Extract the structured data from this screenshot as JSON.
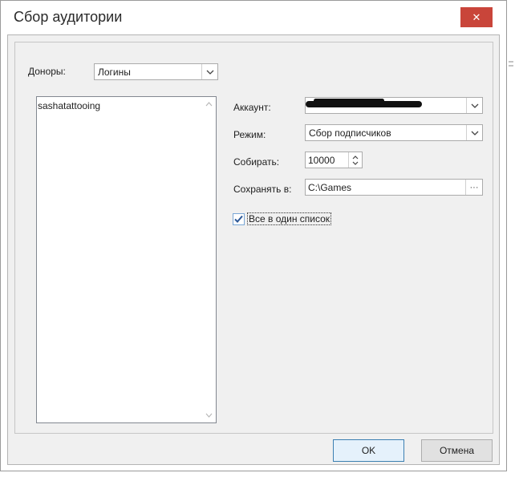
{
  "window": {
    "title": "Сбор аудитории"
  },
  "donors": {
    "label": "Доноры:",
    "type_selected": "Логины",
    "list_items": [
      "sashatattooing"
    ]
  },
  "form": {
    "account_label": "Аккаунт:",
    "mode_label": "Режим:",
    "mode_selected": "Сбор подписчиков",
    "collect_label": "Собирать:",
    "collect_value": "10000",
    "save_label": "Сохранять в:",
    "save_path": "C:\\Games",
    "single_list_label": "Все в один список",
    "single_list_checked": true
  },
  "buttons": {
    "ok": "OK",
    "cancel": "Отмена"
  },
  "colors": {
    "close_bg": "#c9453a",
    "ok_border": "#3c7fb1",
    "checkmark": "#2b5797"
  }
}
